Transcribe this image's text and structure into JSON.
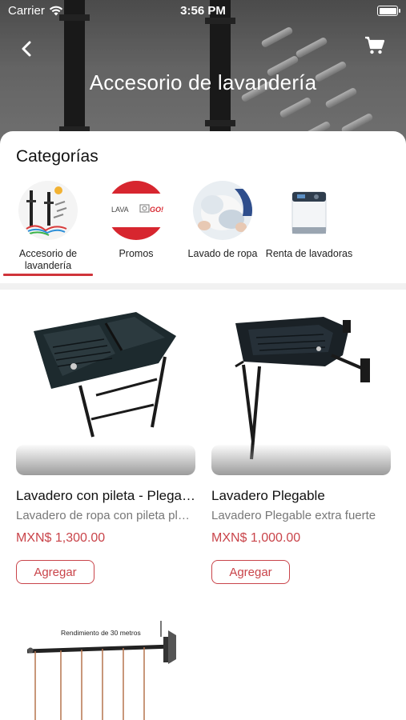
{
  "status_bar": {
    "carrier": "Carrier",
    "time": "3:56 PM"
  },
  "header": {
    "title": "Accesorio de lavandería",
    "back_icon": "chevron-left-icon",
    "cart_icon": "cart-icon"
  },
  "categories": {
    "title": "Categorías",
    "selected_index": 0,
    "items": [
      {
        "label": "Accesorio de lavandería"
      },
      {
        "label": "Promos",
        "logo_text_1": "LAVA",
        "logo_text_2": "GO!"
      },
      {
        "label": "Lavado de ropa"
      },
      {
        "label": "Renta de lavadoras"
      }
    ]
  },
  "products": [
    {
      "name": "Lavadero con pileta - Plegable",
      "description": "Lavadero de ropa con pileta plegable",
      "price": "MXN$ 1,300.00",
      "button": "Agregar"
    },
    {
      "name": "Lavadero Plegable",
      "description": "Lavadero Plegable extra fuerte",
      "price": "MXN$ 1,000.00",
      "button": "Agregar"
    },
    {
      "image_caption": "Rendimiento de 30 metros"
    }
  ],
  "colors": {
    "accent": "#c9444a",
    "underline": "#d0343a"
  }
}
